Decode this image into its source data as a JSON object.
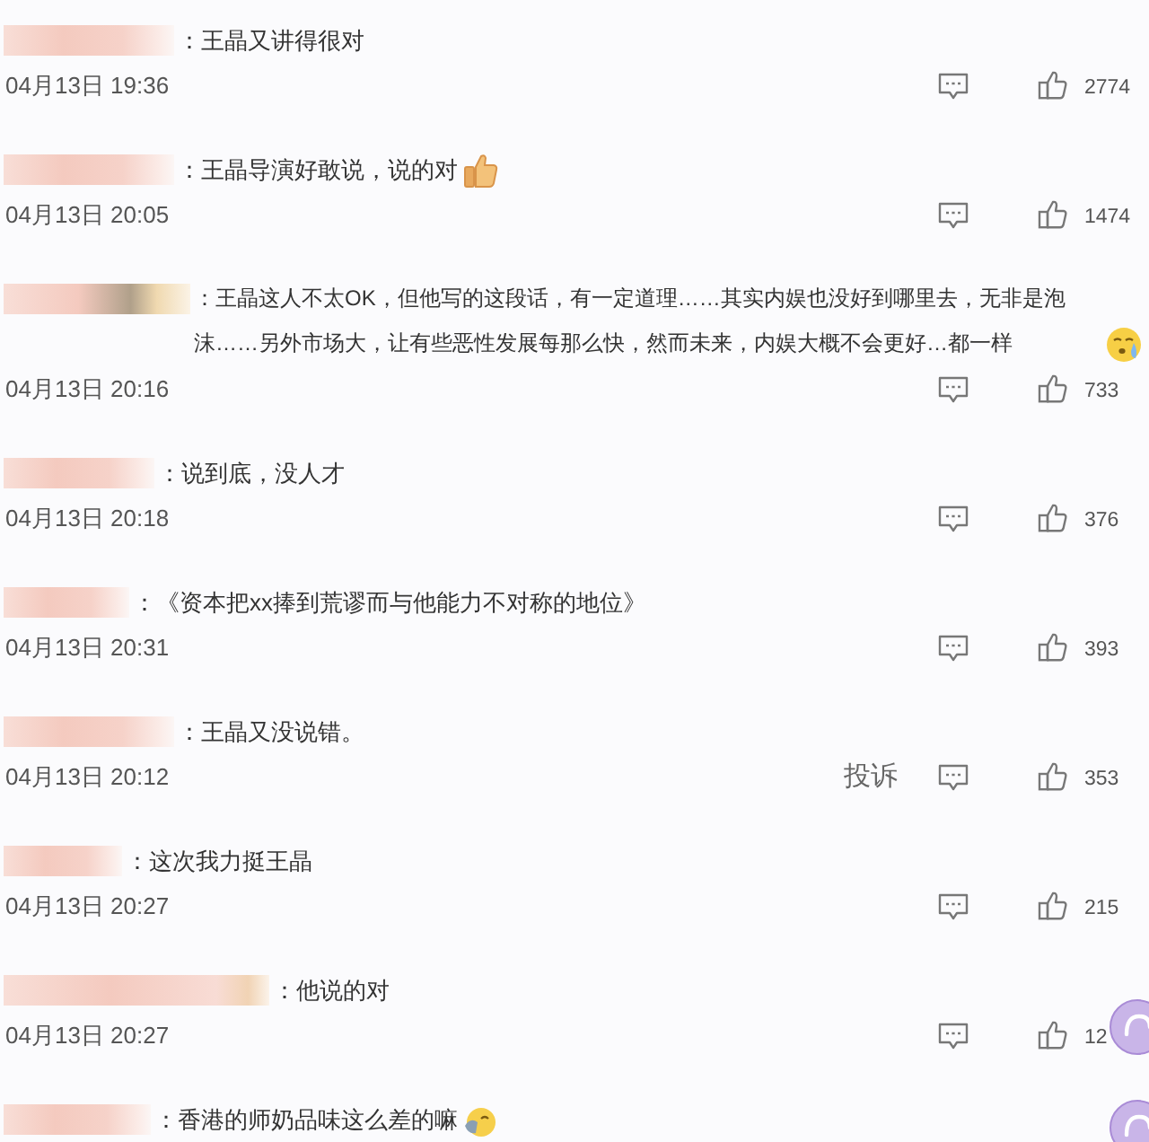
{
  "comments": [
    {
      "text": "：王晶又讲得很对",
      "date": "04月13日 19:36",
      "likes": "2774"
    },
    {
      "text": "：王晶导演好敢说，说的对",
      "emoji": {
        "kind": "thumbs_up"
      },
      "date": "04月13日 20:05",
      "likes": "1474"
    },
    {
      "text": "：王晶这人不太OK，但他写的这段话，有一定道理……其实内娱也没好到哪里去，无非是泡沫……另外市场大，让有些恶性发展每那么快，然而未来，内娱大概不会更好…都一样",
      "emoji": {
        "kind": "crying"
      },
      "date": "04月13日 20:16",
      "likes": "733"
    },
    {
      "text": "：说到底，没人才",
      "date": "04月13日 20:18",
      "likes": "376"
    },
    {
      "text": "：《资本把xx捧到荒谬而与他能力不对称的地位》",
      "date": "04月13日 20:31",
      "likes": "393"
    },
    {
      "text": "：王晶又没说错。",
      "date": "04月13日 20:12",
      "report": "投诉",
      "likes": "353"
    },
    {
      "text": "：这次我力挺王晶",
      "date": "04月13日 20:27",
      "likes": "215"
    },
    {
      "text": "：他说的对",
      "date": "04月13日 20:27",
      "likes": "12"
    },
    {
      "text": "：香港的师奶品味这么差的嘛",
      "emoji": {
        "kind": "face"
      }
    }
  ]
}
